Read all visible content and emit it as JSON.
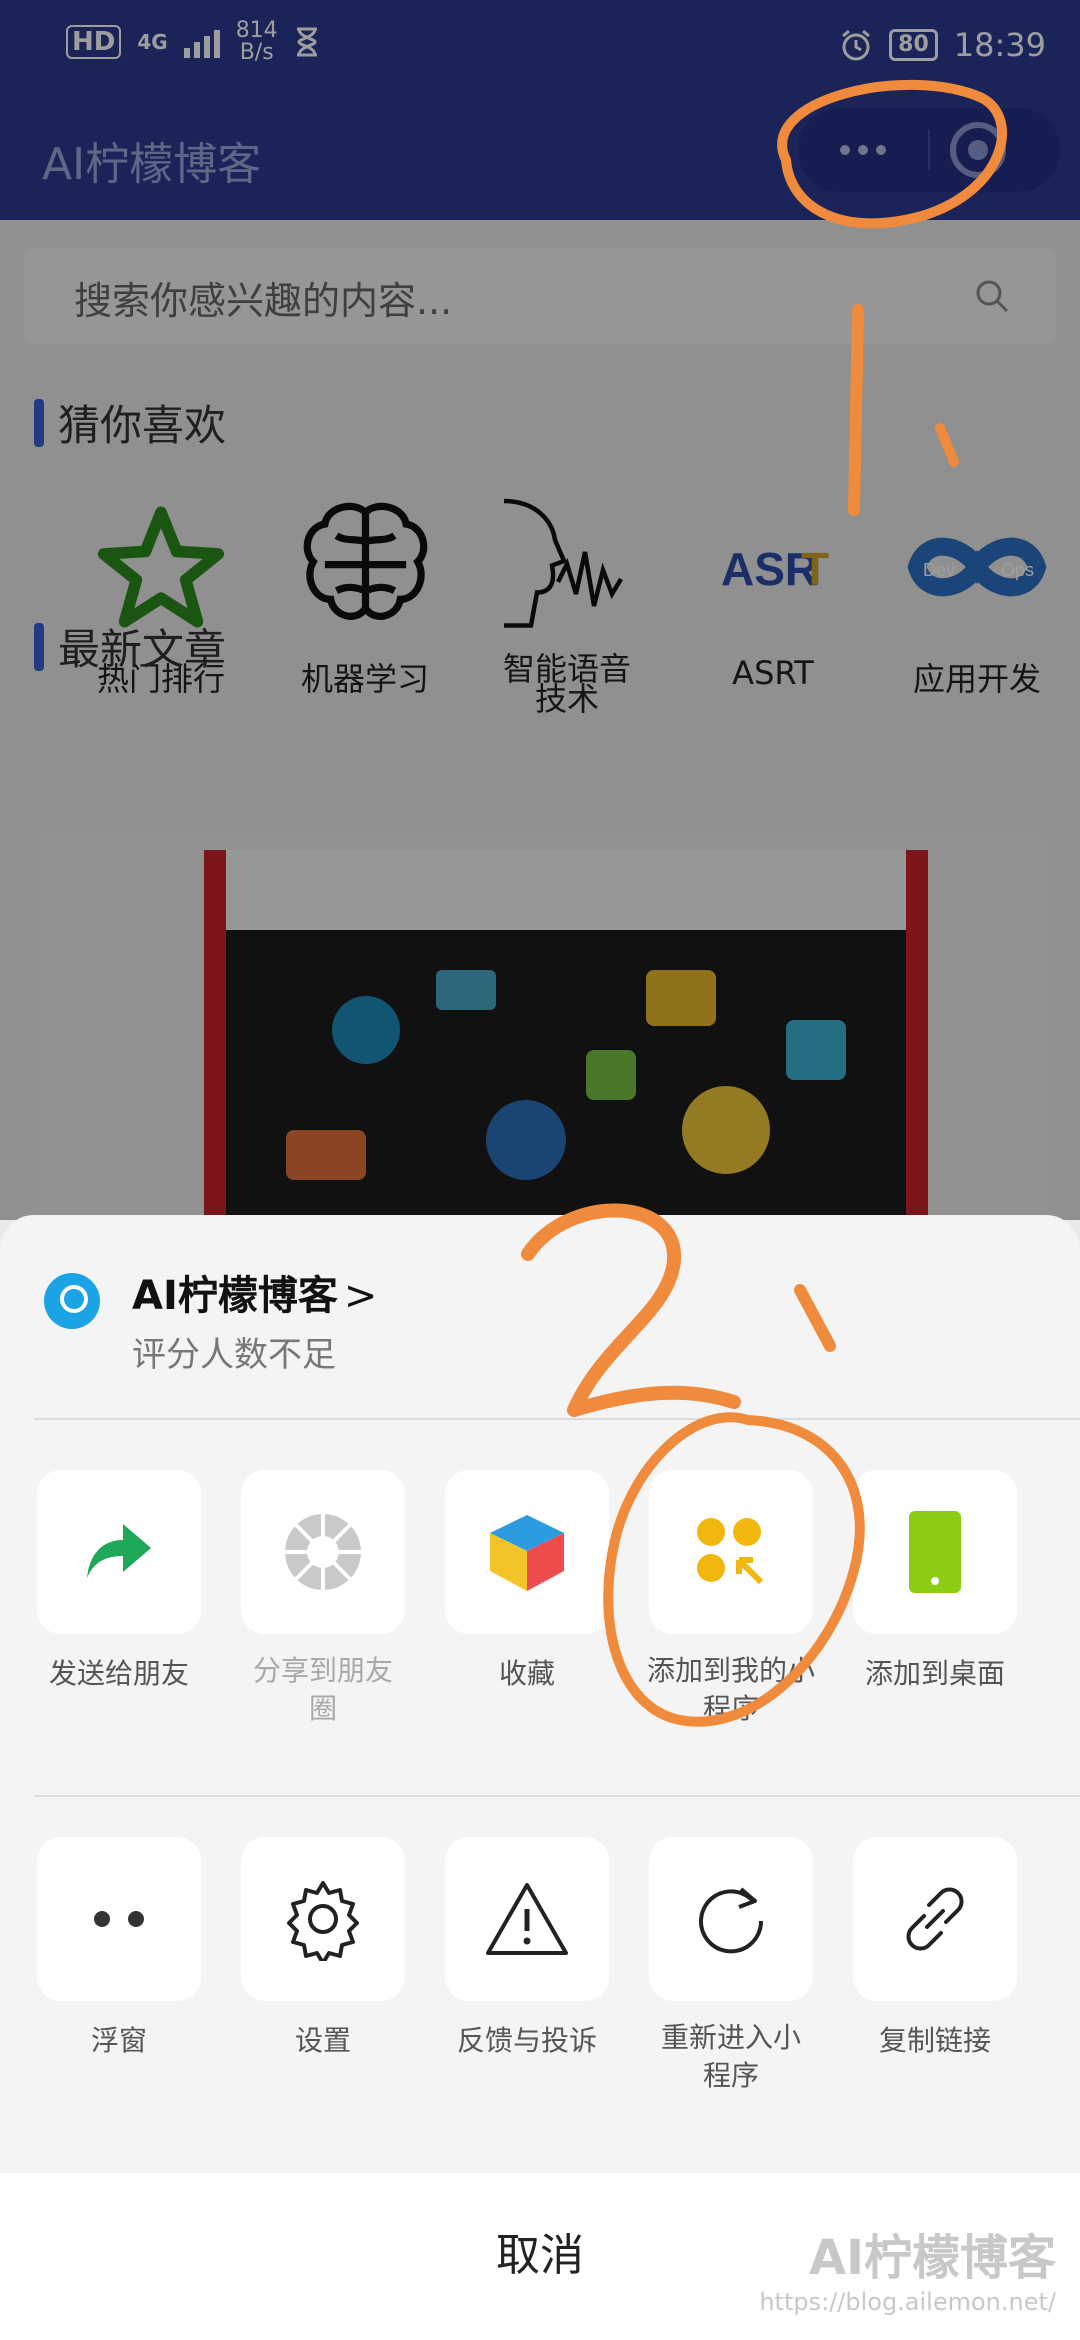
{
  "status_bar": {
    "hd": "HD",
    "network": "4G",
    "speed_value": "814",
    "speed_unit": "B/s",
    "battery": "80",
    "time": "18:39"
  },
  "title_bar": {
    "title": "AI柠檬博客"
  },
  "search": {
    "placeholder": "搜索你感兴趣的内容..."
  },
  "sections": {
    "guess": "猜你喜欢",
    "latest": "最新文章"
  },
  "categories": [
    {
      "label": "热门排行",
      "icon": "star-icon"
    },
    {
      "label": "机器学习",
      "icon": "brain-icon"
    },
    {
      "label": "智能语音技术",
      "icon": "voice-icon"
    },
    {
      "label": "ASRT",
      "icon": "asrt-logo"
    },
    {
      "label": "应用开发",
      "icon": "devops-icon"
    }
  ],
  "sheet": {
    "app_name": "AI柠檬博客",
    "chevron": ">",
    "rating": "评分人数不足",
    "row1": [
      {
        "label": "发送给朋友",
        "icon": "share-arrow-icon"
      },
      {
        "label": "分享到朋友圈",
        "icon": "moments-shutter-icon"
      },
      {
        "label": "收藏",
        "icon": "cube-icon"
      },
      {
        "label": "添加到我的小程序",
        "icon": "add-miniprogram-icon"
      },
      {
        "label": "添加到桌面",
        "icon": "desktop-phone-icon"
      }
    ],
    "row2": [
      {
        "label": "浮窗",
        "icon": "dots-icon"
      },
      {
        "label": "设置",
        "icon": "gear-icon"
      },
      {
        "label": "反馈与投诉",
        "icon": "warning-icon"
      },
      {
        "label": "重新进入小程序",
        "icon": "reload-icon"
      },
      {
        "label": "复制链接",
        "icon": "link-icon"
      }
    ],
    "cancel": "取消"
  },
  "annotations": {
    "step1": "1、",
    "step2": "2、",
    "color": "#f08a3c"
  },
  "watermark": {
    "title": "AI柠檬博客",
    "url": "https://blog.ailemon.net/"
  }
}
